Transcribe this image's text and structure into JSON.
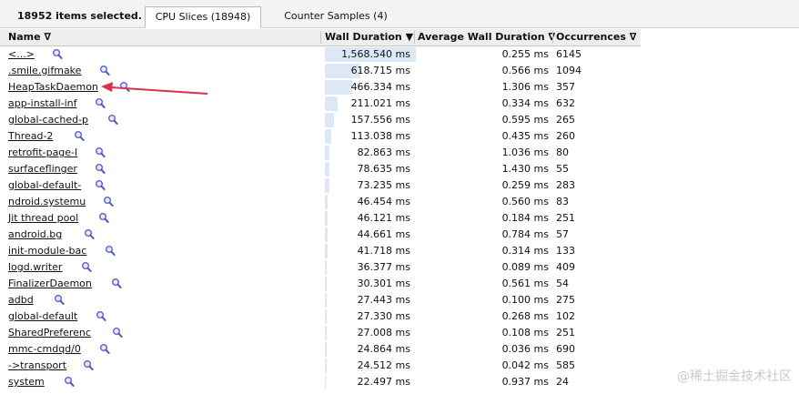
{
  "toolbar": {
    "selected_count": "18952 items selected.",
    "tabs": [
      {
        "label": "CPU Slices (18948)",
        "active": true
      },
      {
        "label": "Counter Samples (4)",
        "active": false
      }
    ]
  },
  "table": {
    "headers": {
      "name": "Name ∇",
      "wall": "Wall Duration ▼",
      "avg": "Average Wall Duration ∇",
      "occ": "Occurrences ∇"
    },
    "rows": [
      {
        "name": "<...>",
        "wall": "1,568.540 ms",
        "wall_fraction": 1.0,
        "avg": "0.255 ms",
        "occ": "6145"
      },
      {
        "name": ".smile.gifmake",
        "wall": "618.715 ms",
        "wall_fraction": 0.394,
        "avg": "0.566 ms",
        "occ": "1094"
      },
      {
        "name": "HeapTaskDaemon",
        "wall": "466.334 ms",
        "wall_fraction": 0.297,
        "avg": "1.306 ms",
        "occ": "357"
      },
      {
        "name": "app-install-inf",
        "wall": "211.021 ms",
        "wall_fraction": 0.135,
        "avg": "0.334 ms",
        "occ": "632"
      },
      {
        "name": "global-cached-p",
        "wall": "157.556 ms",
        "wall_fraction": 0.1,
        "avg": "0.595 ms",
        "occ": "265"
      },
      {
        "name": "Thread-2",
        "wall": "113.038 ms",
        "wall_fraction": 0.072,
        "avg": "0.435 ms",
        "occ": "260"
      },
      {
        "name": "retrofit-page-l",
        "wall": "82.863 ms",
        "wall_fraction": 0.053,
        "avg": "1.036 ms",
        "occ": "80"
      },
      {
        "name": "surfaceflinger",
        "wall": "78.635 ms",
        "wall_fraction": 0.05,
        "avg": "1.430 ms",
        "occ": "55"
      },
      {
        "name": "global-default-",
        "wall": "73.235 ms",
        "wall_fraction": 0.047,
        "avg": "0.259 ms",
        "occ": "283"
      },
      {
        "name": "ndroid.systemu",
        "wall": "46.454 ms",
        "wall_fraction": 0.03,
        "avg": "0.560 ms",
        "occ": "83"
      },
      {
        "name": "Jit thread pool",
        "wall": "46.121 ms",
        "wall_fraction": 0.029,
        "avg": "0.184 ms",
        "occ": "251"
      },
      {
        "name": "android.bg",
        "wall": "44.661 ms",
        "wall_fraction": 0.028,
        "avg": "0.784 ms",
        "occ": "57"
      },
      {
        "name": "init-module-bac",
        "wall": "41.718 ms",
        "wall_fraction": 0.027,
        "avg": "0.314 ms",
        "occ": "133"
      },
      {
        "name": "logd.writer",
        "wall": "36.377 ms",
        "wall_fraction": 0.023,
        "avg": "0.089 ms",
        "occ": "409"
      },
      {
        "name": "FinalizerDaemon",
        "wall": "30.301 ms",
        "wall_fraction": 0.019,
        "avg": "0.561 ms",
        "occ": "54"
      },
      {
        "name": "adbd",
        "wall": "27.443 ms",
        "wall_fraction": 0.017,
        "avg": "0.100 ms",
        "occ": "275"
      },
      {
        "name": "global-default",
        "wall": "27.330 ms",
        "wall_fraction": 0.017,
        "avg": "0.268 ms",
        "occ": "102"
      },
      {
        "name": "SharedPreferenc",
        "wall": "27.008 ms",
        "wall_fraction": 0.017,
        "avg": "0.108 ms",
        "occ": "251"
      },
      {
        "name": "mmc-cmdqd/0",
        "wall": "24.864 ms",
        "wall_fraction": 0.016,
        "avg": "0.036 ms",
        "occ": "690"
      },
      {
        "name": "->transport",
        "wall": "24.512 ms",
        "wall_fraction": 0.016,
        "avg": "0.042 ms",
        "occ": "585"
      },
      {
        "name": "system",
        "wall": "22.497 ms",
        "wall_fraction": 0.014,
        "avg": "0.937 ms",
        "occ": "24"
      }
    ]
  },
  "icons": {
    "row_action": "magnifier-icon"
  },
  "colors": {
    "wall_bar": "#dde8f7",
    "annotation_arrow": "#d9324e"
  },
  "watermark": "@稀土掘金技术社区"
}
